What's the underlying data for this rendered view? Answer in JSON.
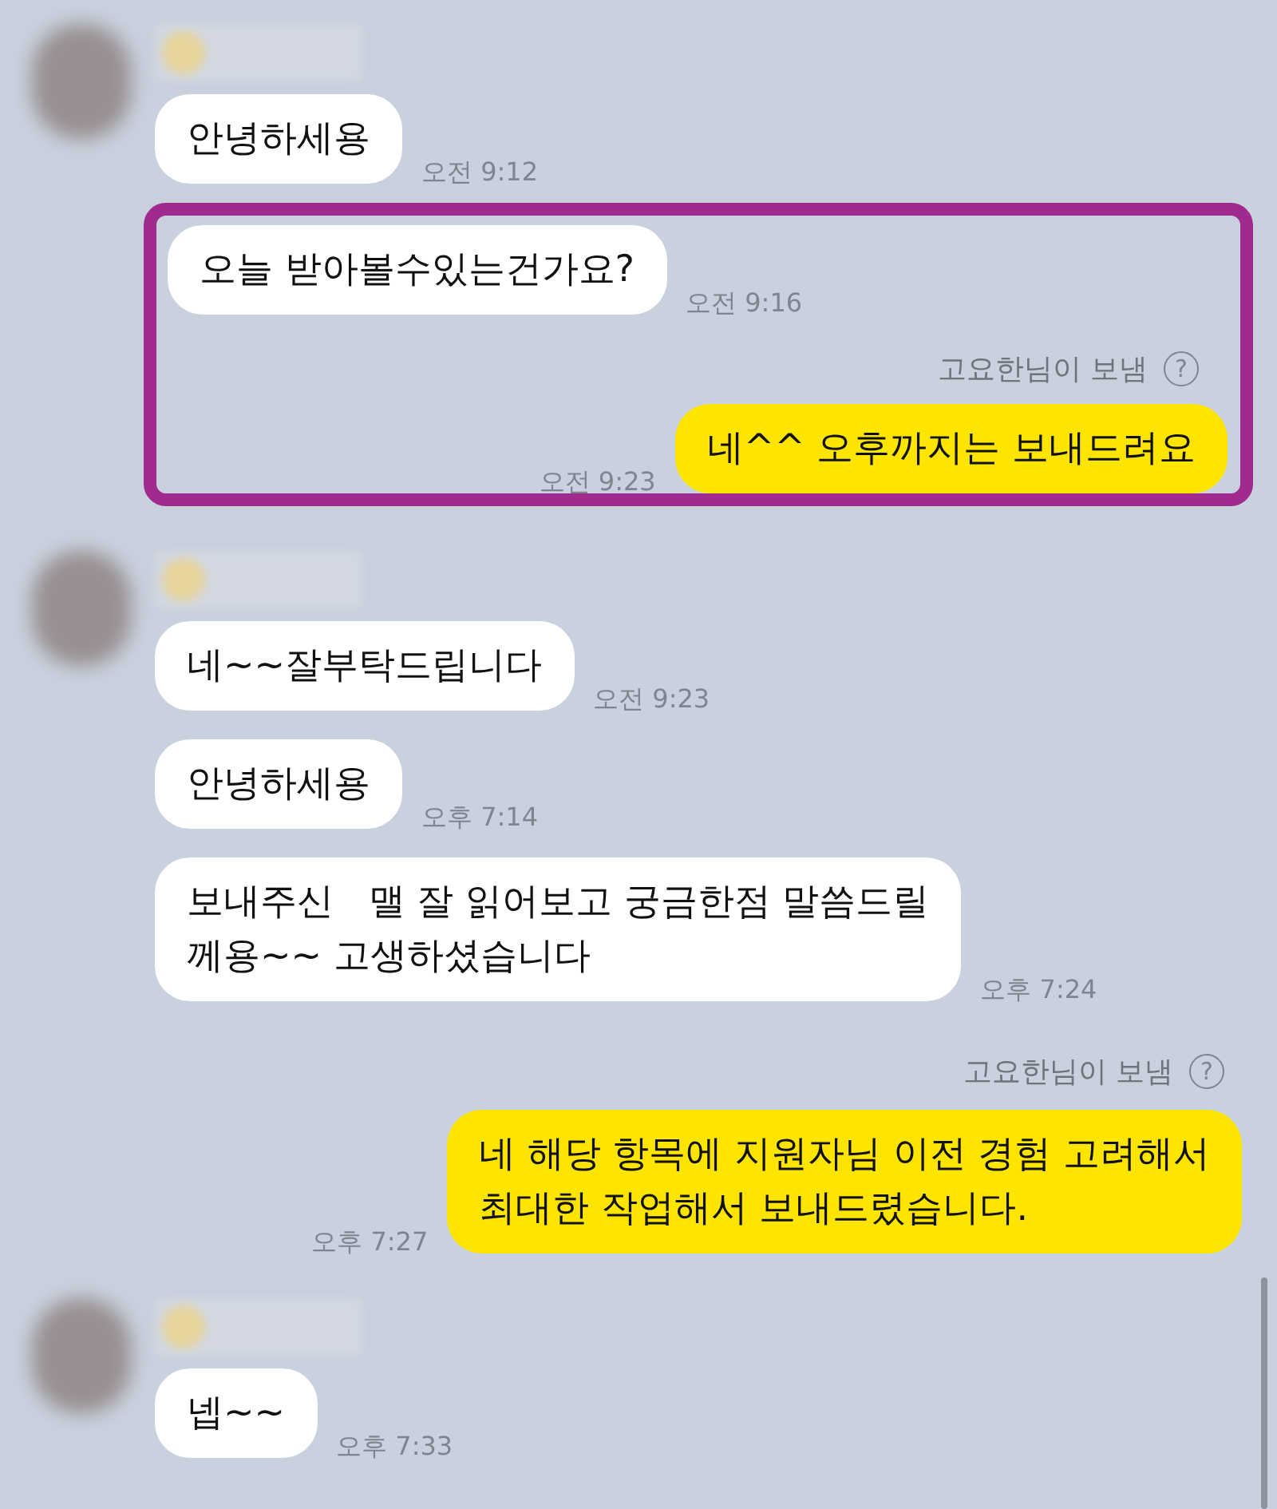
{
  "items": [
    {
      "kind": "received",
      "show_avatar": true,
      "text": "안녕하세용",
      "time": "오전 9:12"
    },
    {
      "kind": "highlight",
      "messages": [
        {
          "kind": "received",
          "show_avatar": false,
          "text": "오늘 받아볼수있는건가요?",
          "time": "오전 9:16"
        },
        {
          "kind": "sent",
          "sender_note": "고요한님이 보냄",
          "help": "?",
          "text": "네^^ 오후까지는 보내드려요",
          "time": "오전 9:23"
        }
      ]
    },
    {
      "kind": "received",
      "show_avatar": true,
      "text": "네~~잘부탁드립니다",
      "time": "오전 9:23"
    },
    {
      "kind": "received",
      "show_avatar": false,
      "text": "안녕하세용",
      "time": "오후 7:14"
    },
    {
      "kind": "received",
      "show_avatar": false,
      "text": "보내주신   맬 잘 읽어보고 궁금한점 말씀드릴\n께용~~ 고생하셨습니다",
      "time": "오후 7:24"
    },
    {
      "kind": "sent",
      "sender_note": "고요한님이 보냄",
      "help": "?",
      "text": "네 해당 항목에 지원자님 이전 경험 고려해서\n최대한 작업해서 보내드렸습니다.",
      "time": "오후 7:27"
    },
    {
      "kind": "received",
      "show_avatar": true,
      "text": "넵~~",
      "time": "오후 7:33"
    }
  ]
}
